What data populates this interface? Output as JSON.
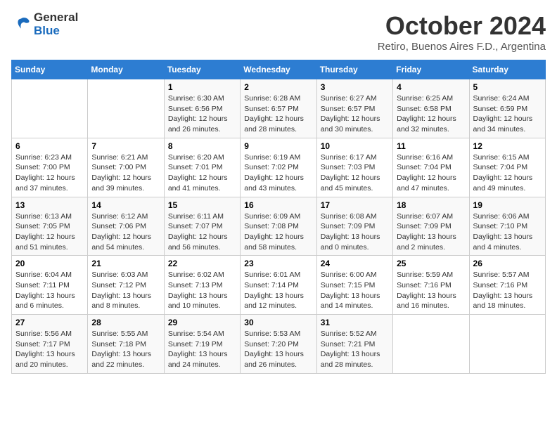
{
  "logo": {
    "line1": "General",
    "line2": "Blue"
  },
  "title": "October 2024",
  "subtitle": "Retiro, Buenos Aires F.D., Argentina",
  "days_of_week": [
    "Sunday",
    "Monday",
    "Tuesday",
    "Wednesday",
    "Thursday",
    "Friday",
    "Saturday"
  ],
  "weeks": [
    [
      {
        "day": "",
        "info": ""
      },
      {
        "day": "",
        "info": ""
      },
      {
        "day": "1",
        "info": "Sunrise: 6:30 AM\nSunset: 6:56 PM\nDaylight: 12 hours and 26 minutes."
      },
      {
        "day": "2",
        "info": "Sunrise: 6:28 AM\nSunset: 6:57 PM\nDaylight: 12 hours and 28 minutes."
      },
      {
        "day": "3",
        "info": "Sunrise: 6:27 AM\nSunset: 6:57 PM\nDaylight: 12 hours and 30 minutes."
      },
      {
        "day": "4",
        "info": "Sunrise: 6:25 AM\nSunset: 6:58 PM\nDaylight: 12 hours and 32 minutes."
      },
      {
        "day": "5",
        "info": "Sunrise: 6:24 AM\nSunset: 6:59 PM\nDaylight: 12 hours and 34 minutes."
      }
    ],
    [
      {
        "day": "6",
        "info": "Sunrise: 6:23 AM\nSunset: 7:00 PM\nDaylight: 12 hours and 37 minutes."
      },
      {
        "day": "7",
        "info": "Sunrise: 6:21 AM\nSunset: 7:00 PM\nDaylight: 12 hours and 39 minutes."
      },
      {
        "day": "8",
        "info": "Sunrise: 6:20 AM\nSunset: 7:01 PM\nDaylight: 12 hours and 41 minutes."
      },
      {
        "day": "9",
        "info": "Sunrise: 6:19 AM\nSunset: 7:02 PM\nDaylight: 12 hours and 43 minutes."
      },
      {
        "day": "10",
        "info": "Sunrise: 6:17 AM\nSunset: 7:03 PM\nDaylight: 12 hours and 45 minutes."
      },
      {
        "day": "11",
        "info": "Sunrise: 6:16 AM\nSunset: 7:04 PM\nDaylight: 12 hours and 47 minutes."
      },
      {
        "day": "12",
        "info": "Sunrise: 6:15 AM\nSunset: 7:04 PM\nDaylight: 12 hours and 49 minutes."
      }
    ],
    [
      {
        "day": "13",
        "info": "Sunrise: 6:13 AM\nSunset: 7:05 PM\nDaylight: 12 hours and 51 minutes."
      },
      {
        "day": "14",
        "info": "Sunrise: 6:12 AM\nSunset: 7:06 PM\nDaylight: 12 hours and 54 minutes."
      },
      {
        "day": "15",
        "info": "Sunrise: 6:11 AM\nSunset: 7:07 PM\nDaylight: 12 hours and 56 minutes."
      },
      {
        "day": "16",
        "info": "Sunrise: 6:09 AM\nSunset: 7:08 PM\nDaylight: 12 hours and 58 minutes."
      },
      {
        "day": "17",
        "info": "Sunrise: 6:08 AM\nSunset: 7:09 PM\nDaylight: 13 hours and 0 minutes."
      },
      {
        "day": "18",
        "info": "Sunrise: 6:07 AM\nSunset: 7:09 PM\nDaylight: 13 hours and 2 minutes."
      },
      {
        "day": "19",
        "info": "Sunrise: 6:06 AM\nSunset: 7:10 PM\nDaylight: 13 hours and 4 minutes."
      }
    ],
    [
      {
        "day": "20",
        "info": "Sunrise: 6:04 AM\nSunset: 7:11 PM\nDaylight: 13 hours and 6 minutes."
      },
      {
        "day": "21",
        "info": "Sunrise: 6:03 AM\nSunset: 7:12 PM\nDaylight: 13 hours and 8 minutes."
      },
      {
        "day": "22",
        "info": "Sunrise: 6:02 AM\nSunset: 7:13 PM\nDaylight: 13 hours and 10 minutes."
      },
      {
        "day": "23",
        "info": "Sunrise: 6:01 AM\nSunset: 7:14 PM\nDaylight: 13 hours and 12 minutes."
      },
      {
        "day": "24",
        "info": "Sunrise: 6:00 AM\nSunset: 7:15 PM\nDaylight: 13 hours and 14 minutes."
      },
      {
        "day": "25",
        "info": "Sunrise: 5:59 AM\nSunset: 7:16 PM\nDaylight: 13 hours and 16 minutes."
      },
      {
        "day": "26",
        "info": "Sunrise: 5:57 AM\nSunset: 7:16 PM\nDaylight: 13 hours and 18 minutes."
      }
    ],
    [
      {
        "day": "27",
        "info": "Sunrise: 5:56 AM\nSunset: 7:17 PM\nDaylight: 13 hours and 20 minutes."
      },
      {
        "day": "28",
        "info": "Sunrise: 5:55 AM\nSunset: 7:18 PM\nDaylight: 13 hours and 22 minutes."
      },
      {
        "day": "29",
        "info": "Sunrise: 5:54 AM\nSunset: 7:19 PM\nDaylight: 13 hours and 24 minutes."
      },
      {
        "day": "30",
        "info": "Sunrise: 5:53 AM\nSunset: 7:20 PM\nDaylight: 13 hours and 26 minutes."
      },
      {
        "day": "31",
        "info": "Sunrise: 5:52 AM\nSunset: 7:21 PM\nDaylight: 13 hours and 28 minutes."
      },
      {
        "day": "",
        "info": ""
      },
      {
        "day": "",
        "info": ""
      }
    ]
  ]
}
